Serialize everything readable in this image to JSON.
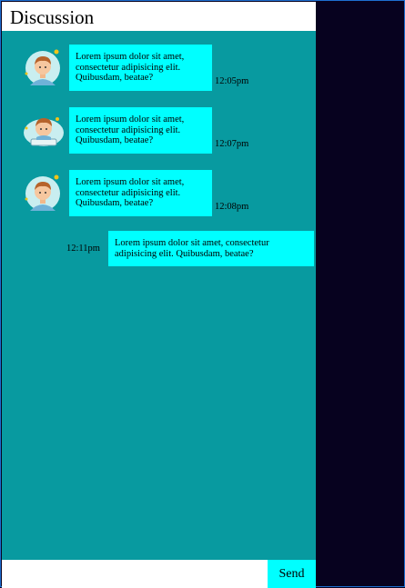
{
  "header": {
    "title": "Discussion"
  },
  "messages": [
    {
      "text": "Lorem ipsum dolor sit amet, consectetur adipisicing elit. Quibusdam, beatae?",
      "time": "12:05pm",
      "avatar": "user-avatar-icon"
    },
    {
      "text": "Lorem ipsum dolor sit amet, consectetur adipisicing elit. Quibusdam, beatae?",
      "time": "12:07pm",
      "avatar": "user-avatar-icon"
    },
    {
      "text": "Lorem ipsum dolor sit amet, consectetur adipisicing elit. Quibusdam, beatae?",
      "time": "12:08pm",
      "avatar": "user-avatar-icon"
    },
    {
      "text": "Lorem ipsum dolor sit amet, consectetur adipisicing elit. Quibusdam, beatae?",
      "time": "12:11pm"
    }
  ],
  "composer": {
    "placeholder": "",
    "send_label": "Send"
  },
  "colors": {
    "panel": "#089aa0",
    "bubble": "#00ffff",
    "sidebar": "#07021f",
    "border": "#1e6fd0"
  }
}
